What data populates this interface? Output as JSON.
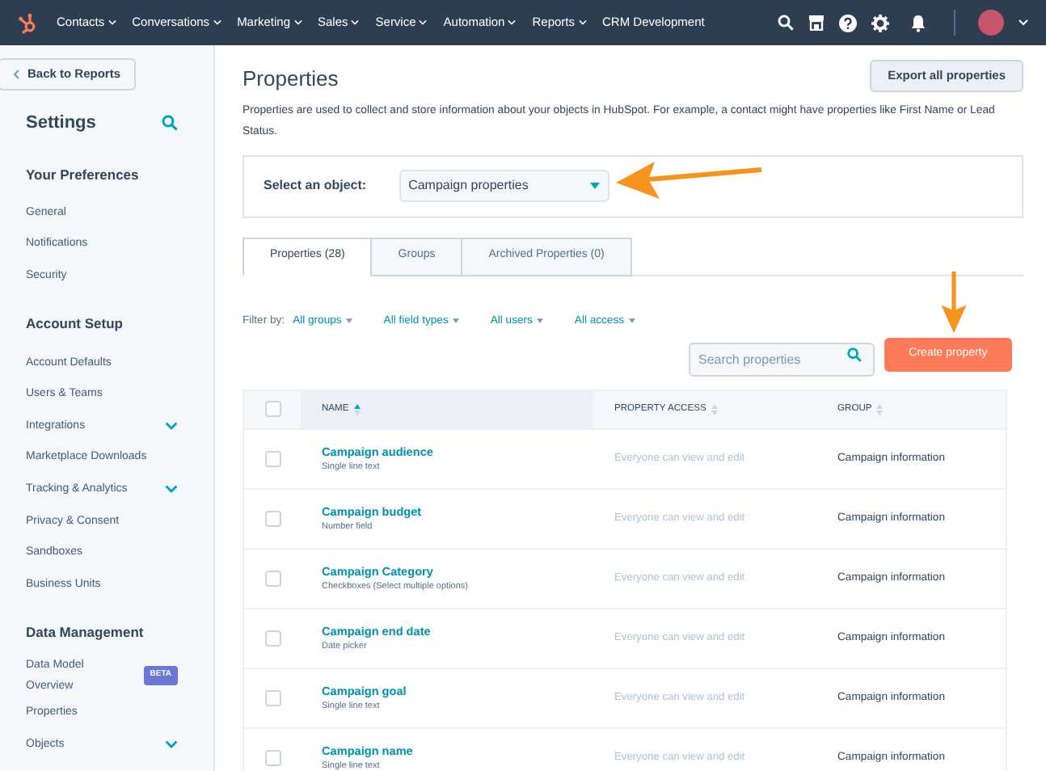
{
  "top_nav": {
    "items": [
      {
        "label": "Contacts",
        "dropdown": true
      },
      {
        "label": "Conversations",
        "dropdown": true
      },
      {
        "label": "Marketing",
        "dropdown": true
      },
      {
        "label": "Sales",
        "dropdown": true
      },
      {
        "label": "Service",
        "dropdown": true
      },
      {
        "label": "Automation",
        "dropdown": true
      },
      {
        "label": "Reports",
        "dropdown": true
      },
      {
        "label": "CRM Development",
        "dropdown": false
      }
    ]
  },
  "sidebar": {
    "back_button": "Back to Reports",
    "title": "Settings",
    "sections": [
      {
        "heading": "Your Preferences",
        "items": [
          {
            "label": "General",
            "expandable": false
          },
          {
            "label": "Notifications",
            "expandable": false
          },
          {
            "label": "Security",
            "expandable": false
          }
        ]
      },
      {
        "heading": "Account Setup",
        "items": [
          {
            "label": "Account Defaults",
            "expandable": false
          },
          {
            "label": "Users & Teams",
            "expandable": false
          },
          {
            "label": "Integrations",
            "expandable": true
          },
          {
            "label": "Marketplace Downloads",
            "expandable": false
          },
          {
            "label": "Tracking & Analytics",
            "expandable": true
          },
          {
            "label": "Privacy & Consent",
            "expandable": false
          },
          {
            "label": "Sandboxes",
            "expandable": false
          },
          {
            "label": "Business Units",
            "expandable": false
          }
        ]
      },
      {
        "heading": "Data Management",
        "items": [
          {
            "label": "Data Model Overview",
            "expandable": false,
            "badge": "BETA"
          },
          {
            "label": "Properties",
            "expandable": false
          },
          {
            "label": "Objects",
            "expandable": true
          }
        ]
      }
    ]
  },
  "page": {
    "title": "Properties",
    "export_button": "Export all properties",
    "description": "Properties are used to collect and store information about your objects in HubSpot. For example, a contact might have properties like First Name or Lead Status.",
    "object_select": {
      "label": "Select an object:",
      "value": "Campaign properties"
    },
    "tabs": [
      {
        "label": "Properties (28)",
        "selected": true
      },
      {
        "label": "Groups",
        "selected": false
      },
      {
        "label": "Archived Properties (0)",
        "selected": false
      }
    ],
    "filter": {
      "label": "Filter by:",
      "options": [
        "All groups",
        "All field types",
        "All users",
        "All access"
      ]
    },
    "search": {
      "placeholder": "Search properties"
    },
    "create_button": "Create property",
    "table": {
      "select_all_checked": false,
      "columns": [
        {
          "label": "NAME",
          "sorted": true
        },
        {
          "label": "PROPERTY ACCESS",
          "sorted": false
        },
        {
          "label": "GROUP",
          "sorted": false
        }
      ],
      "rows": [
        {
          "name": "Campaign audience",
          "type": "Single line text",
          "access": "Everyone can view and edit",
          "group": "Campaign information",
          "checked": false
        },
        {
          "name": "Campaign budget",
          "type": "Number field",
          "access": "Everyone can view and edit",
          "group": "Campaign information",
          "checked": false
        },
        {
          "name": "Campaign Category",
          "type": "Checkboxes (Select multiple options)",
          "access": "Everyone can view and edit",
          "group": "Campaign information",
          "checked": false
        },
        {
          "name": "Campaign end date",
          "type": "Date picker",
          "access": "Everyone can view and edit",
          "group": "Campaign information",
          "checked": false
        },
        {
          "name": "Campaign goal",
          "type": "Single line text",
          "access": "Everyone can view and edit",
          "group": "Campaign information",
          "checked": false
        },
        {
          "name": "Campaign name",
          "type": "Single line text",
          "access": "Everyone can view and edit",
          "group": "Campaign information",
          "checked": false
        }
      ]
    }
  }
}
